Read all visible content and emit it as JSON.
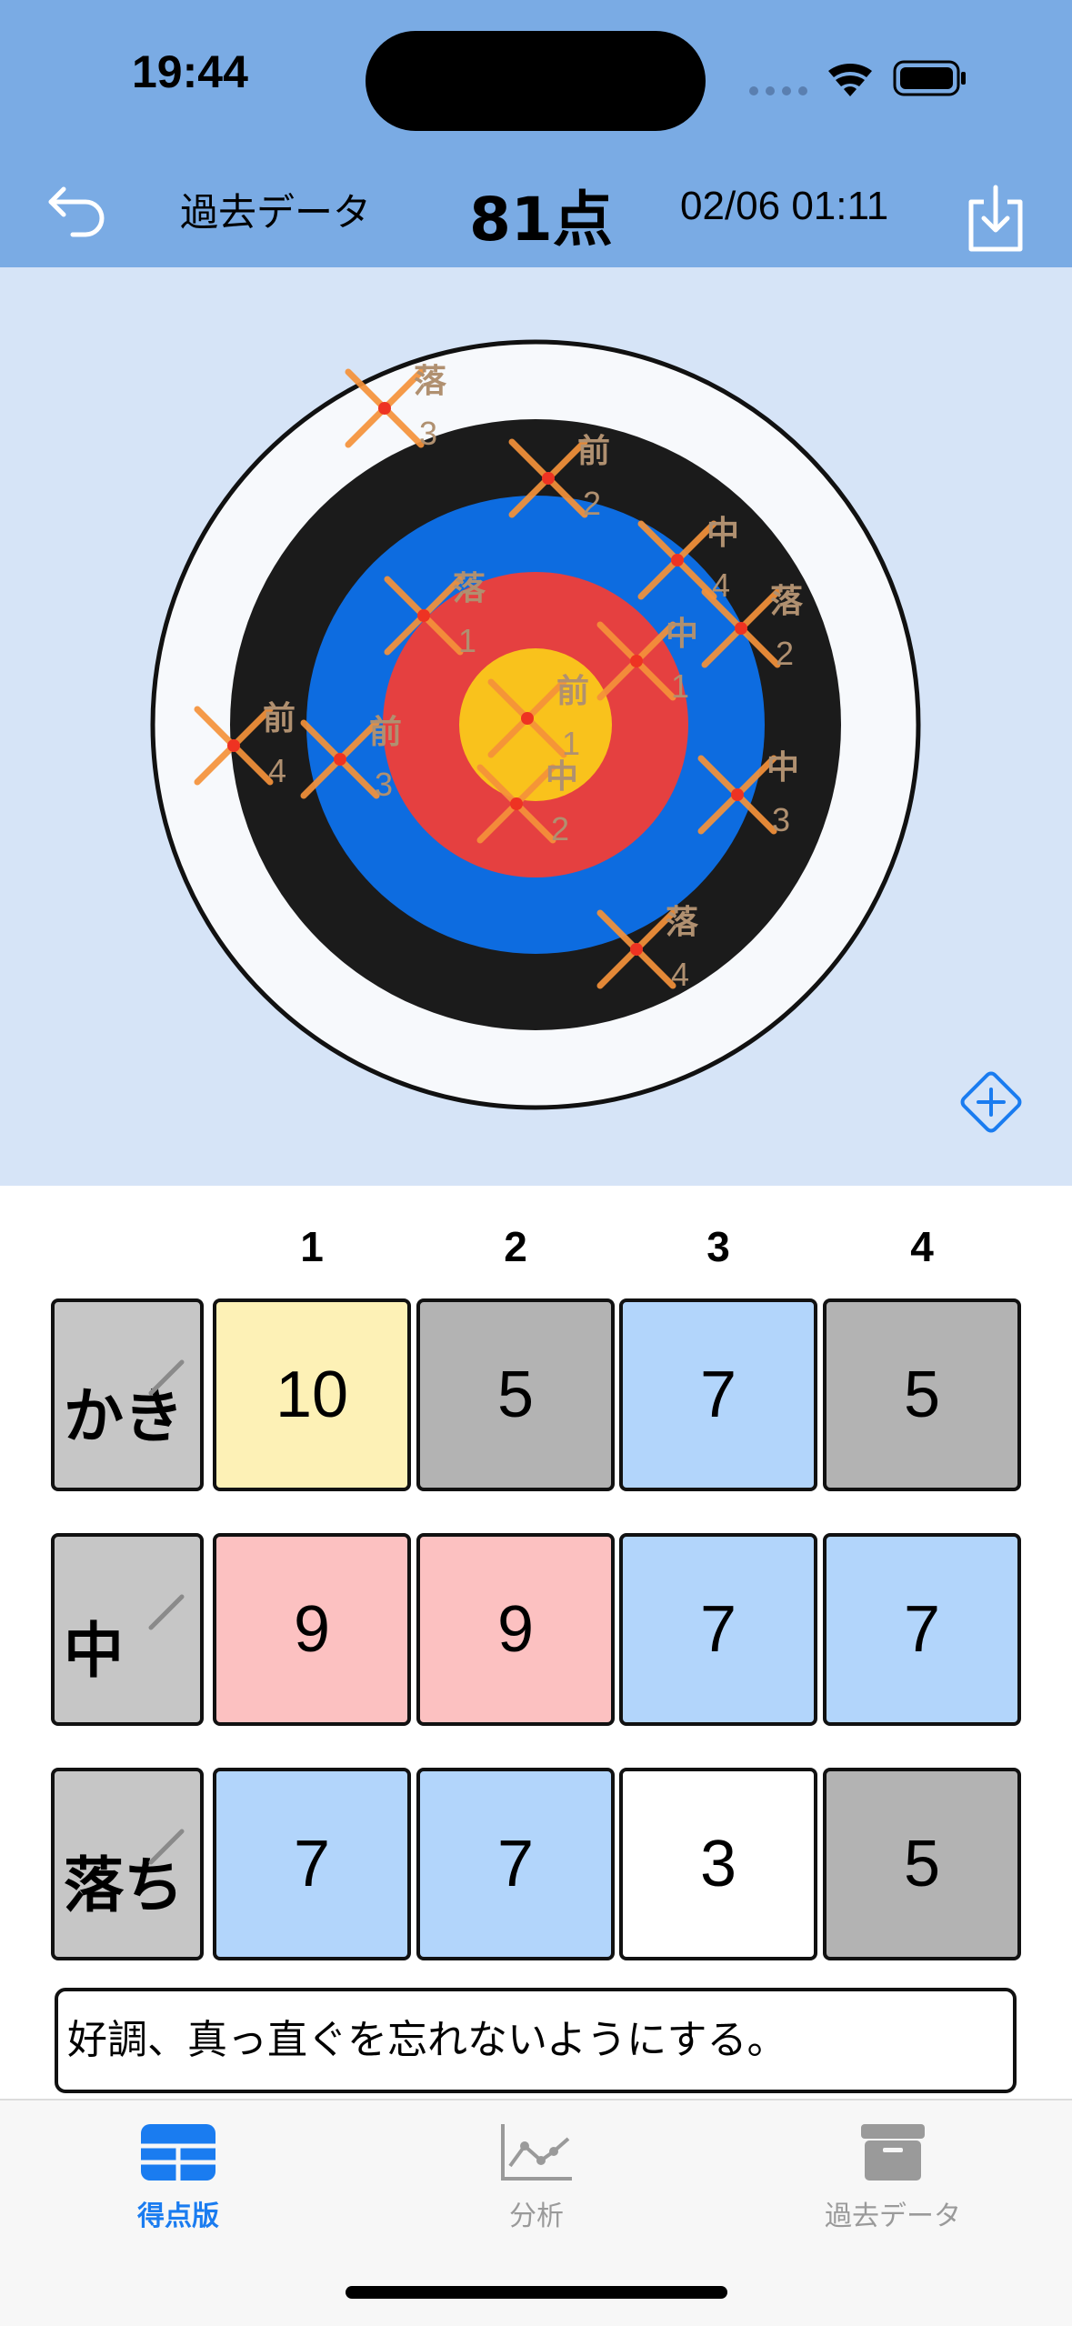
{
  "status": {
    "time": "19:44"
  },
  "header": {
    "back_icon": "undo-arrow-icon",
    "past_label": "過去データ",
    "score": "81点",
    "datetime": "02/06 01:11",
    "download_icon": "download-tray-icon"
  },
  "target": {
    "ring_colors": [
      "#f7f9fc",
      "#1b1b1b",
      "#0d6ce0",
      "#e54040",
      "#f9c21c"
    ],
    "marker_color": "#f5923a",
    "marks": [
      {
        "label": "落",
        "num": "3"
      },
      {
        "label": "前",
        "num": "2"
      },
      {
        "label": "中",
        "num": "4"
      },
      {
        "label": "落",
        "num": "1"
      },
      {
        "label": "落",
        "num": "2"
      },
      {
        "label": "中",
        "num": "1"
      },
      {
        "label": "前",
        "num": "1"
      },
      {
        "label": "前",
        "num": "4"
      },
      {
        "label": "前",
        "num": "3"
      },
      {
        "label": "中",
        "num": "2"
      },
      {
        "label": "中",
        "num": "3"
      },
      {
        "label": "落",
        "num": "4"
      }
    ],
    "add_icon": "plus-diamond-icon"
  },
  "scores": {
    "columns": [
      "1",
      "2",
      "3",
      "4"
    ],
    "rows": [
      {
        "label": "かき",
        "cells": [
          {
            "value": "10",
            "color": "#fdf1b6"
          },
          {
            "value": "5",
            "color": "#b3b3b3"
          },
          {
            "value": "7",
            "color": "#b2d5fb"
          },
          {
            "value": "5",
            "color": "#b3b3b3"
          }
        ]
      },
      {
        "label": "中",
        "cells": [
          {
            "value": "9",
            "color": "#fcc1c1"
          },
          {
            "value": "9",
            "color": "#fcc1c1"
          },
          {
            "value": "7",
            "color": "#b2d5fb"
          },
          {
            "value": "7",
            "color": "#b2d5fb"
          }
        ]
      },
      {
        "label": "落ち",
        "cells": [
          {
            "value": "7",
            "color": "#b2d5fb"
          },
          {
            "value": "7",
            "color": "#b2d5fb"
          },
          {
            "value": "3",
            "color": "#ffffff"
          },
          {
            "value": "5",
            "color": "#b3b3b3"
          }
        ]
      }
    ],
    "memo": "好調、真っ直ぐを忘れないようにする。"
  },
  "tabbar": {
    "tabs": [
      {
        "label": "得点版",
        "icon": "grid-table-icon",
        "active": true
      },
      {
        "label": "分析",
        "icon": "line-chart-icon",
        "active": false
      },
      {
        "label": "過去データ",
        "icon": "archive-box-icon",
        "active": false
      }
    ],
    "active_color": "#1a7cf0",
    "inactive_color": "#9a9a9a"
  }
}
